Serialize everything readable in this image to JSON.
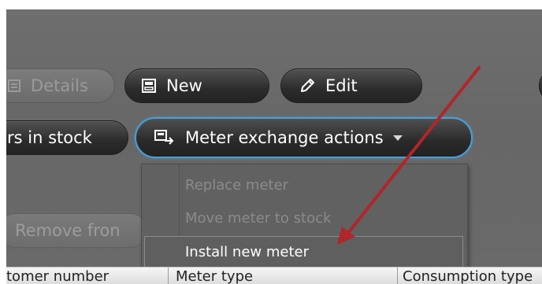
{
  "toolbar_row1": {
    "details_label": "Details",
    "new_label": "New",
    "edit_label": "Edit"
  },
  "toolbar_row2": {
    "stock_label": "rs in stock",
    "exchange_label": "Meter exchange actions"
  },
  "ghost": {
    "remove_label": "Remove fron"
  },
  "menu": {
    "items": [
      {
        "label": "Replace meter",
        "enabled": false
      },
      {
        "label": "Move meter to stock",
        "enabled": false
      },
      {
        "label": "Install new meter",
        "enabled": true
      }
    ]
  },
  "grid": {
    "columns": [
      "tomer number",
      "Meter type",
      "Consumption type"
    ]
  },
  "colors": {
    "focus_border": "#4a9ed8",
    "arrow": "#b0262a",
    "panel_bg": "#6a6a6a"
  },
  "icons": [
    "details-icon",
    "new-icon",
    "edit-pencil-icon",
    "meter-exchange-icon",
    "dropdown-caret-icon",
    "annotation-arrow"
  ]
}
